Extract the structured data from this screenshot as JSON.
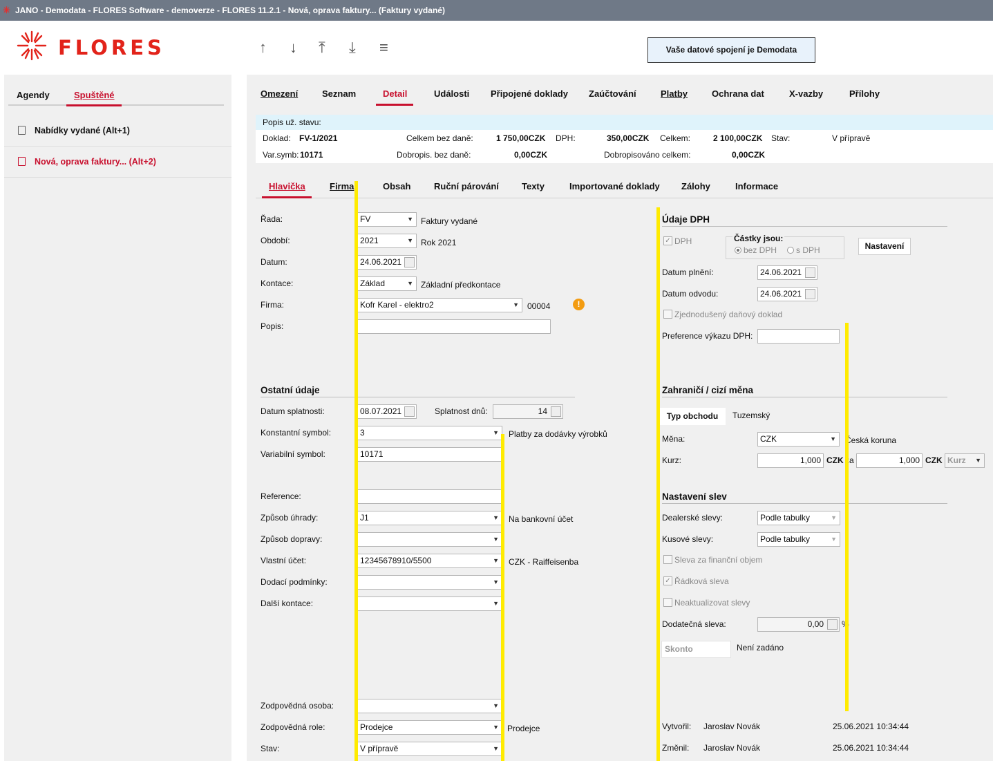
{
  "window": {
    "title": "JANO - Demodata - FLORES Software - demoverze - FLORES 11.2.1 - Nová, oprava faktury... (Faktury vydané)"
  },
  "logo": {
    "text": "FLORES",
    "color": "#e2231a"
  },
  "left": {
    "tabs": [
      "Agendy",
      "Spuštěné"
    ],
    "items": [
      "Nabídky vydané (Alt+1)",
      "Nová, oprava faktury... (Alt+2)"
    ]
  },
  "toolbar": {
    "icons": [
      "arrow-up-icon",
      "arrow-down-icon",
      "arrow-first-icon",
      "arrow-last-icon",
      "menu-icon"
    ],
    "connection": "Vaše datové spojení je Demodata"
  },
  "main_tabs": [
    "Omezení",
    "Seznam",
    "Detail",
    "Události",
    "Připojené doklady",
    "Zaúčtování",
    "Platby",
    "Ochrana dat",
    "X-vazby",
    "Přílohy"
  ],
  "info": {
    "popis": "Popis už. stavu:",
    "doklad_lbl": "Doklad:",
    "doklad": "FV-1/2021",
    "celkem_bez_lbl": "Celkem bez daně:",
    "celkem_bez": "1 750,00CZK",
    "dph_lbl": "DPH:",
    "dph": "350,00CZK",
    "celkem_lbl": "Celkem:",
    "celkem": "2 100,00CZK",
    "stav_lbl": "Stav:",
    "stav": "V přípravě",
    "varsymb_lbl": "Var.symb:",
    "varsymb": "10171",
    "dobropis_bez_lbl": "Dobropis. bez daně:",
    "dobropis_bez": "0,00CZK",
    "dobropisovano_lbl": "Dobropisováno celkem:",
    "dobropisovano": "0,00CZK"
  },
  "sub_tabs": [
    "Hlavička",
    "Firma",
    "Obsah",
    "Ruční párování",
    "Texty",
    "Importované doklady",
    "Zálohy",
    "Informace"
  ],
  "head": {
    "rada_lbl": "Řada:",
    "rada": "FV",
    "rada_name": "Faktury vydané",
    "obdobi_lbl": "Období:",
    "obdobi": "2021",
    "obdobi_name": "Rok 2021",
    "datum_lbl": "Datum:",
    "datum": "24.06.2021",
    "kontace_lbl": "Kontace:",
    "kontace": "Základ",
    "kontace_name": "Základní předkontace",
    "firma_lbl": "Firma:",
    "firma": "Kofr Karel - elektro2",
    "firma_code": "00004",
    "popis_lbl": "Popis:",
    "popis": ""
  },
  "ostatni": {
    "title": "Ostatní údaje",
    "splat_lbl": "Datum splatnosti:",
    "splat": "08.07.2021",
    "splatdnu_lbl": "Splatnost dnů:",
    "splatdnu": "14",
    "ks_lbl": "Konstantní symbol:",
    "ks": "3",
    "ks_name": "Platby za dodávky výrobků",
    "vs_lbl": "Variabilní symbol:",
    "vs": "10171",
    "ref_lbl": "Reference:",
    "ref": "",
    "uhrada_lbl": "Způsob úhrady:",
    "uhrada": "J1",
    "uhrada_name": "Na bankovní účet",
    "doprava_lbl": "Způsob dopravy:",
    "doprava": "",
    "ucet_lbl": "Vlastní účet:",
    "ucet": "12345678910/5500",
    "ucet_name": "CZK - Raiffeisenba",
    "podminky_lbl": "Dodací podmínky:",
    "podminky": "",
    "dalsi_lbl": "Další kontace:",
    "dalsi": "",
    "osoba_lbl": "Zodpovědná osoba:",
    "osoba": "",
    "role_lbl": "Zodpovědná role:",
    "role": "Prodejce",
    "role_name": "Prodejce",
    "stav_lbl": "Stav:",
    "stav": "V přípravě"
  },
  "dph": {
    "title": "Údaje DPH",
    "dph_chk": "DPH",
    "castky": "Částky jsou:",
    "bez": "bez DPH",
    "s": "s DPH",
    "nastaveni": "Nastavení",
    "plneni_lbl": "Datum plnění:",
    "plneni": "24.06.2021",
    "odvod_lbl": "Datum odvodu:",
    "odvod": "24.06.2021",
    "zjed": "Zjednodušený daňový doklad",
    "pref_lbl": "Preference výkazu DPH:",
    "pref": ""
  },
  "zahr": {
    "title": "Zahraničí / cizí měna",
    "typ_btn": "Typ obchodu",
    "typ": "Tuzemský",
    "mena_lbl": "Měna:",
    "mena": "CZK",
    "mena_name": "Česká koruna",
    "kurz_lbl": "Kurz:",
    "kurz1": "1,000",
    "kurz_cur": "CZK",
    "za": "za",
    "kurz2": "1,000",
    "kurz_cur2": "CZK",
    "kurz_btn": "Kurz"
  },
  "slevy": {
    "title": "Nastavení slev",
    "dealer_lbl": "Dealerské slevy:",
    "dealer": "Podle tabulky",
    "kus_lbl": "Kusové slevy:",
    "kus": "Podle tabulky",
    "fin": "Sleva za finanční objem",
    "radk": "Řádková sleva",
    "neakt": "Neaktualizovat slevy",
    "dod_lbl": "Dodatečná sleva:",
    "dod": "0,00",
    "pct": "%",
    "skonto": "Skonto",
    "skonto_val": "Není zadáno"
  },
  "audit": {
    "vytvoril_lbl": "Vytvořil:",
    "vytvoril": "Jaroslav Novák",
    "vytvoril_dt": "25.06.2021 10:34:44",
    "zmenil_lbl": "Změnil:",
    "zmenil": "Jaroslav Novák",
    "zmenil_dt": "25.06.2021 10:34:44"
  }
}
